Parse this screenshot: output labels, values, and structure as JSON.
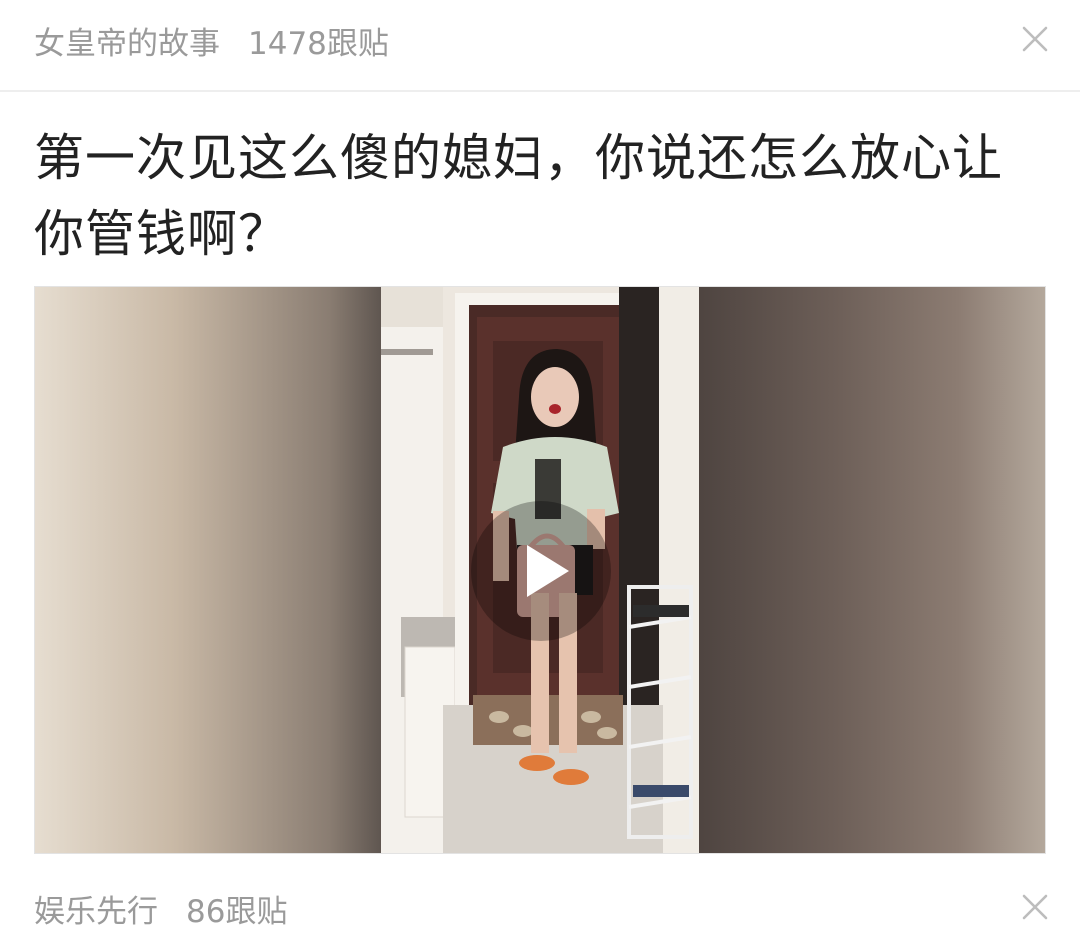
{
  "top_card": {
    "source": "女皇帝的故事",
    "reply_count": "1478跟贴",
    "close_icon": "close-icon"
  },
  "article": {
    "title_line1": "第一次见这么傻的媳妇，你说还怎么放心让",
    "title_line2": "你管钱啊？"
  },
  "video": {
    "play_icon": "play-icon"
  },
  "bottom_card": {
    "source": "娱乐先行",
    "reply_count": "86跟贴",
    "close_icon": "close-icon"
  }
}
